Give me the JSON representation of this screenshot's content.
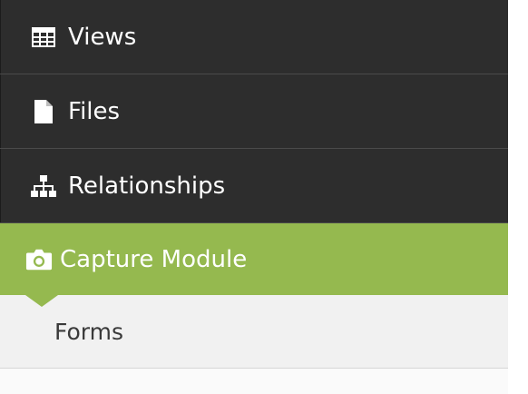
{
  "nav": {
    "items": [
      {
        "label": "Views",
        "icon": "table-icon"
      },
      {
        "label": "Files",
        "icon": "file-icon"
      },
      {
        "label": "Relationships",
        "icon": "sitemap-icon"
      },
      {
        "label": "Capture Module",
        "icon": "camera-icon",
        "active": true
      }
    ],
    "sub_items": [
      {
        "label": "Forms"
      }
    ]
  },
  "colors": {
    "nav_background": "#2d2d2d",
    "active_accent": "#95b94f",
    "sub_background": "#f1f1f1",
    "text_light": "#ffffff",
    "text_dark": "#3a3a3a"
  }
}
